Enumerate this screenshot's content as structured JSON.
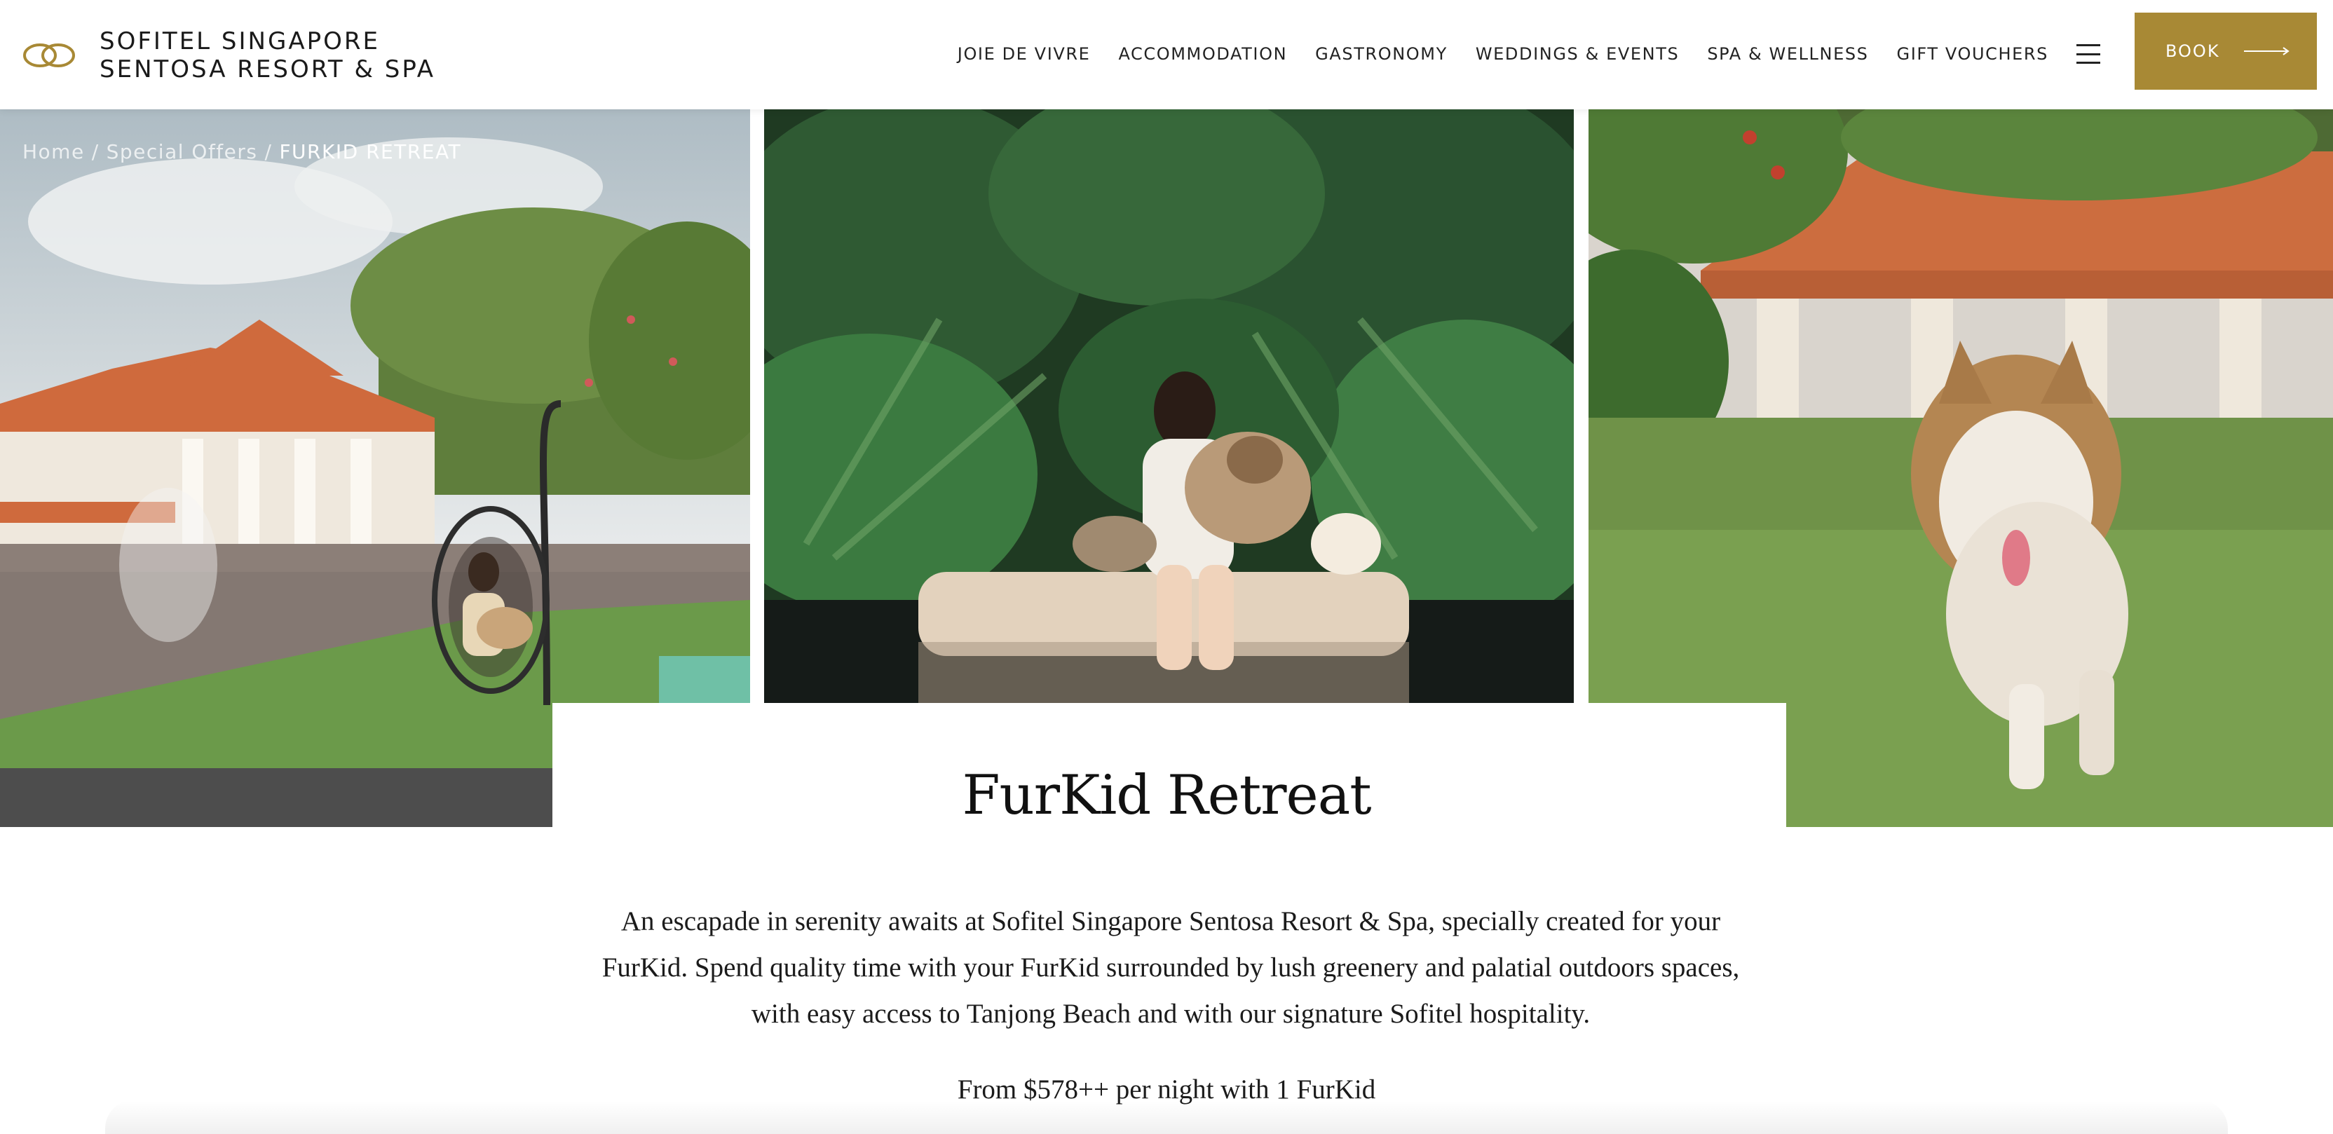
{
  "header": {
    "logo_line1": "SOFITEL SINGAPORE",
    "logo_line2": "SENTOSA RESORT & SPA",
    "nav": [
      {
        "label": "JOIE DE VIVRE"
      },
      {
        "label": "ACCOMMODATION"
      },
      {
        "label": "GASTRONOMY"
      },
      {
        "label": "WEDDINGS & EVENTS"
      },
      {
        "label": "SPA & WELLNESS"
      },
      {
        "label": "GIFT VOUCHERS"
      }
    ],
    "book_label": "BOOK",
    "brand_color": "#a88935"
  },
  "breadcrumb": {
    "home": "Home",
    "offers": "Special Offers",
    "current": "FURKID RETREAT",
    "separator": "/"
  },
  "offer": {
    "title": "FurKid Retreat",
    "description": "An escapade in serenity awaits at Sofitel Singapore Sentosa Resort & Spa, specially created for your FurKid. Spend quality time with your FurKid surrounded by lush greenery and palatial outdoors spaces, with easy access to Tanjong Beach and with our signature Sofitel hospitality.",
    "price": "From $578++ per night with 1 FurKid"
  }
}
